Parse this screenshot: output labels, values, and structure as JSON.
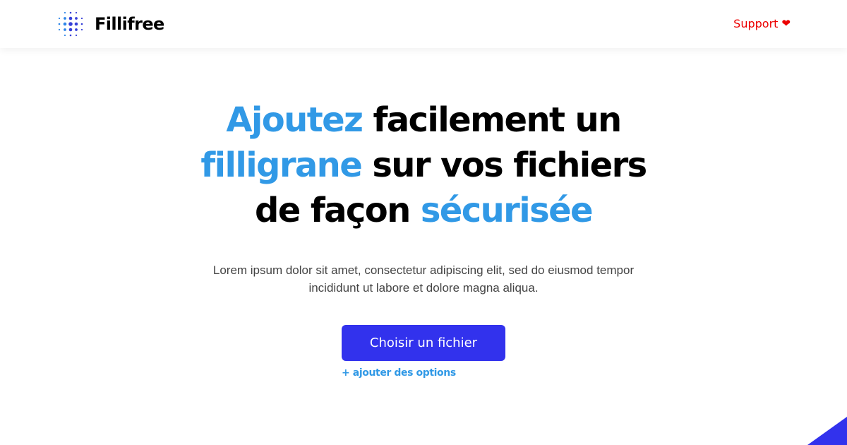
{
  "header": {
    "brand": {
      "logo_icon": "dotted-circle-logo-icon",
      "name": "Fillifree"
    },
    "support": {
      "label": "Support",
      "icon": "heart-icon",
      "icon_glyph": "❤"
    }
  },
  "hero": {
    "headline": {
      "line1": {
        "accent": "Ajoutez",
        "rest": " facilement un"
      },
      "line2": {
        "accent": "filligrane",
        "rest": " sur vos fichiers"
      },
      "line3": {
        "lead": "de façon ",
        "accent": "sécurisée"
      }
    },
    "subtitle": {
      "line1": "Lorem ipsum dolor sit amet, consectetur adipiscing elit, sed do eiusmod tempor",
      "line2": "incididunt ut labore et dolore magna aliqua."
    },
    "cta": {
      "label": "Choisir un fichier"
    },
    "options_link": "+ ajouter des options"
  },
  "colors": {
    "accent_blue": "#3199e6",
    "button_blue": "#3232ed",
    "support_red": "#ec0000",
    "text_dark": "#000000",
    "text_muted": "#444444",
    "corner_shape": "#3232ed"
  }
}
